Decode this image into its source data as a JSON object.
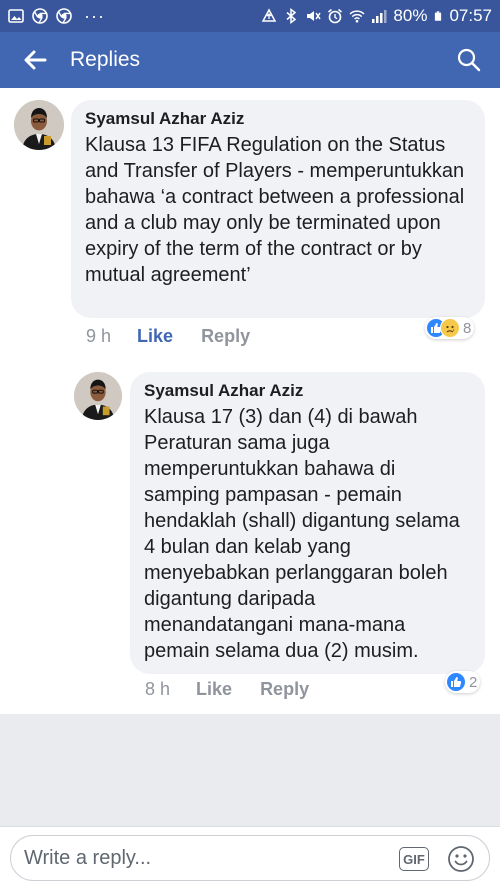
{
  "status_bar": {
    "battery": "80%",
    "time": "07:57",
    "left_icons": [
      "gallery-icon",
      "chrome-icon",
      "chrome-icon",
      "more-dots-icon"
    ],
    "right_icons": [
      "upload-icon",
      "bluetooth-icon",
      "mute-icon",
      "alarm-icon",
      "wifi-icon",
      "signal-icon",
      "battery-icon"
    ]
  },
  "header": {
    "title": "Replies"
  },
  "comments": [
    {
      "author": "Syamsul Azhar Aziz",
      "text": "Klausa 13 FIFA Regulation on the Status and Transfer of Players - memperuntukkan bahawa ‘a contract between a professional and a club may only be terminated upon expiry of the term of the contract or by mutual agreement’",
      "time": "9 h",
      "like_label": "Like",
      "reply_label": "Reply",
      "reaction_count": "8",
      "reactions": [
        "like",
        "sad"
      ]
    },
    {
      "author": "Syamsul Azhar Aziz",
      "text": "Klausa 17 (3) dan (4) di bawah Peraturan sama juga memperuntukkan bahawa di samping pampasan - pemain hendaklah (shall) digantung selama 4 bulan dan kelab yang menyebabkan perlanggaran boleh digantung daripada menandatangani mana-mana pemain selama dua (2) musim.",
      "time": "8 h",
      "like_label": "Like",
      "reply_label": "Reply",
      "reaction_count": "2",
      "reactions": [
        "like"
      ]
    }
  ],
  "composer": {
    "placeholder": "Write a reply...",
    "gif_label": "GIF"
  },
  "colors": {
    "statusbar": "#39569c",
    "appbar": "#4267b2",
    "like_active": "#4267b2",
    "meta_grey": "#90949c",
    "bubble": "#f1f2f6",
    "page_bg": "#e9ebee"
  }
}
